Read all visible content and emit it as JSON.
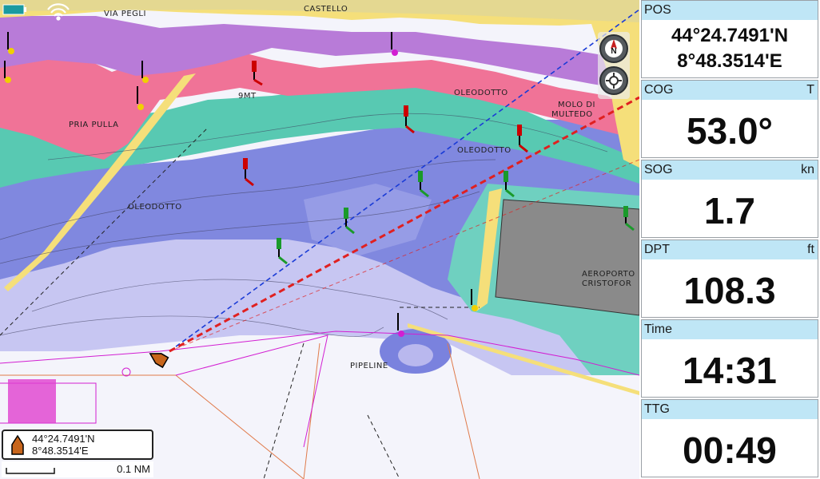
{
  "map": {
    "labels": {
      "via_pegli": "VIA PEGLI",
      "castello": "CASTELLO",
      "pria_pulla": "PRIA PULLA",
      "oleodotto_1": "OLEODOTTO",
      "oleodotto_2": "OLEODOTTO",
      "oleodotto_3": "OLEODOTTO",
      "molo_line1": "MOLO DI",
      "molo_line2": "MULTEDO",
      "nine_mt": "9MT",
      "aeroporto_line1": "AEROPORTO",
      "aeroporto_line2": "CRISTOFOR",
      "pipeline": "PIPELINE"
    },
    "scale_label": "0.1 NM",
    "status_icons": [
      "battery-icon",
      "wifi-icon"
    ],
    "colors": {
      "land": "#f5df7a",
      "shallow_magenta": "#b57ad6",
      "shallow_pink": "#f07498",
      "shoal_green": "#58c9b2",
      "mid_blue": "#7d86e0",
      "deep_lavender": "#c8c8f2",
      "deepest_white": "#f2f2fb",
      "course_line": "#e02020",
      "heading_line": "#1a3bd6"
    }
  },
  "controls": {
    "north_button_icon": "north-up-icon",
    "center_button_icon": "recenter-icon"
  },
  "position_box": {
    "lat": "44°24.7491'N",
    "lon": "8°48.3514'E"
  },
  "panel": [
    {
      "key": "pos",
      "label": "POS",
      "unit": "",
      "lines": [
        "44°24.7491'N",
        "8°48.3514'E"
      ]
    },
    {
      "key": "cog",
      "label": "COG",
      "unit": "T",
      "value": "53.0°"
    },
    {
      "key": "sog",
      "label": "SOG",
      "unit": "kn",
      "value": "1.7"
    },
    {
      "key": "dpt",
      "label": "DPT",
      "unit": "ft",
      "value": "108.3"
    },
    {
      "key": "time",
      "label": "Time",
      "unit": "",
      "value": "14:31"
    },
    {
      "key": "ttg",
      "label": "TTG",
      "unit": "",
      "value": "00:49"
    }
  ]
}
